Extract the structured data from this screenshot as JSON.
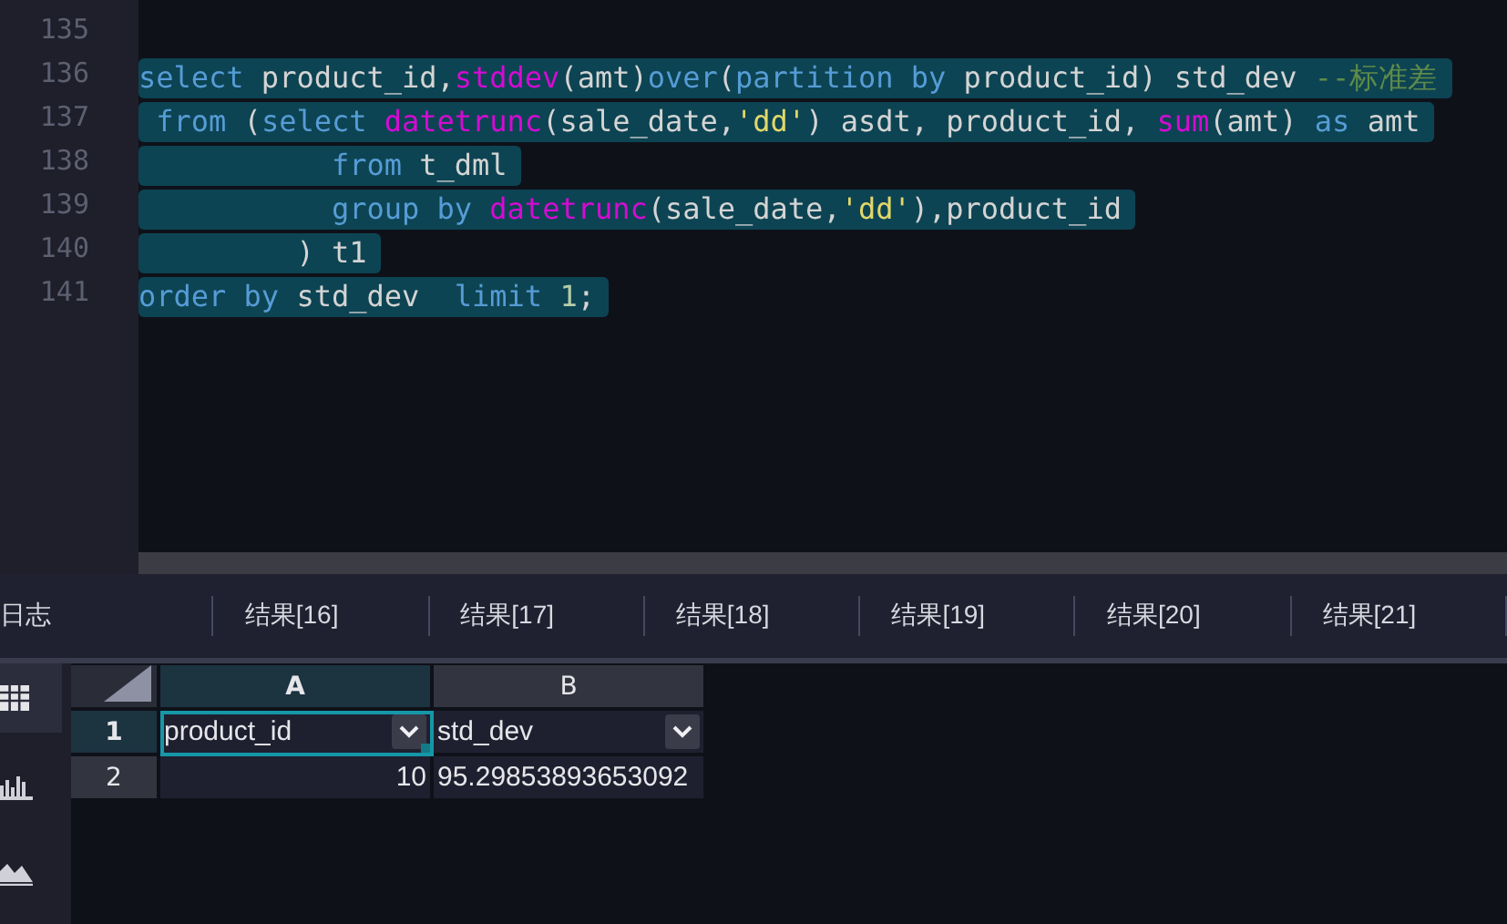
{
  "editor": {
    "lines": [
      {
        "number": "135"
      },
      {
        "number": "136",
        "selected": true,
        "tokens": [
          {
            "kind": "keyword",
            "text": "select"
          },
          {
            "kind": "plain",
            "text": " product_id,"
          },
          {
            "kind": "function",
            "text": "stddev"
          },
          {
            "kind": "plain",
            "text": "(amt)"
          },
          {
            "kind": "keyword",
            "text": "over"
          },
          {
            "kind": "plain",
            "text": "("
          },
          {
            "kind": "keyword",
            "text": "partition by"
          },
          {
            "kind": "plain",
            "text": " product_id) std_dev "
          },
          {
            "kind": "comment",
            "text": "--标准差"
          }
        ]
      },
      {
        "number": "137",
        "selected": true,
        "tokens": [
          {
            "kind": "keyword",
            "text": " from"
          },
          {
            "kind": "plain",
            "text": " ("
          },
          {
            "kind": "keyword",
            "text": "select"
          },
          {
            "kind": "function",
            "text": " datetrunc"
          },
          {
            "kind": "plain",
            "text": "(sale_date,"
          },
          {
            "kind": "string",
            "text": "'dd'"
          },
          {
            "kind": "plain",
            "text": ") asdt, product_id, "
          },
          {
            "kind": "function",
            "text": "sum"
          },
          {
            "kind": "plain",
            "text": "(amt) "
          },
          {
            "kind": "keyword",
            "text": "as"
          },
          {
            "kind": "plain",
            "text": " amt"
          }
        ]
      },
      {
        "number": "138",
        "selected": true,
        "tokens": [
          {
            "kind": "keyword",
            "text": "           from"
          },
          {
            "kind": "plain",
            "text": " t_dml"
          }
        ]
      },
      {
        "number": "139",
        "selected": true,
        "tokens": [
          {
            "kind": "keyword",
            "text": "           group by"
          },
          {
            "kind": "function",
            "text": " datetrunc"
          },
          {
            "kind": "plain",
            "text": "(sale_date,"
          },
          {
            "kind": "string",
            "text": "'dd'"
          },
          {
            "kind": "plain",
            "text": "),product_id"
          }
        ]
      },
      {
        "number": "140",
        "selected": true,
        "tokens": [
          {
            "kind": "plain",
            "text": "         ) t1"
          }
        ]
      },
      {
        "number": "141",
        "selected": true,
        "tokens": [
          {
            "kind": "keyword",
            "text": "order by"
          },
          {
            "kind": "plain",
            "text": " std_dev  "
          },
          {
            "kind": "keyword",
            "text": "limit "
          },
          {
            "kind": "number",
            "text": "1"
          },
          {
            "kind": "plain",
            "text": ";"
          }
        ]
      }
    ]
  },
  "result_tabs": [
    {
      "label": "日志"
    },
    {
      "label": "结果[16]"
    },
    {
      "label": "结果[17]"
    },
    {
      "label": "结果[18]"
    },
    {
      "label": "结果[19]"
    },
    {
      "label": "结果[20]"
    },
    {
      "label": "结果[21]"
    }
  ],
  "side_tools": [
    {
      "kind": "table",
      "selected": true
    },
    {
      "kind": "bar_chart",
      "selected": false
    },
    {
      "kind": "area_chart",
      "selected": false
    }
  ],
  "grid": {
    "columns": [
      {
        "label": "A",
        "selected": true
      },
      {
        "label": "B",
        "selected": false
      }
    ],
    "rows": [
      {
        "number": "1",
        "selected": true,
        "cells": [
          {
            "kind": "header_field",
            "text": "product_id",
            "active": true
          },
          {
            "kind": "header_field",
            "text": "std_dev",
            "active": false
          }
        ]
      },
      {
        "number": "2",
        "selected": false,
        "cells": [
          {
            "kind": "number",
            "text": "10",
            "active": false
          },
          {
            "kind": "text",
            "text": "95.29853893653092",
            "active": false
          }
        ]
      }
    ]
  }
}
